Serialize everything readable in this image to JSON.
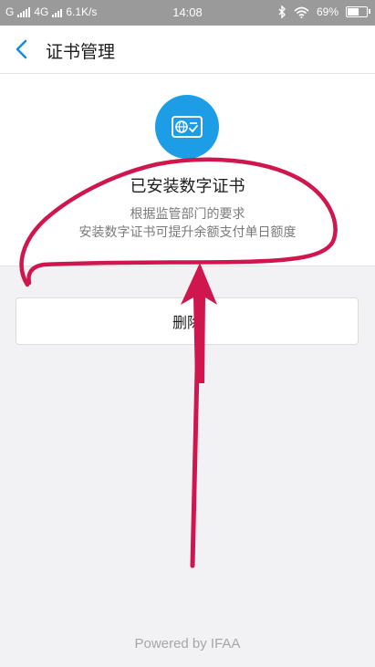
{
  "status_bar": {
    "carrier_1": "G",
    "carrier_2": "4G",
    "network_speed": "6.1K/s",
    "time": "14:08",
    "battery": "69%",
    "battery_level": 0.69,
    "icons": [
      "signal-icon",
      "bluetooth-icon",
      "wifi-icon",
      "battery-icon"
    ]
  },
  "nav": {
    "title": "证书管理",
    "back_icon": "chevron-left-icon"
  },
  "certificate": {
    "icon": "globe-certificate-icon",
    "status_title": "已安装数字证书",
    "desc_line1": "根据监管部门的要求",
    "desc_line2": "安装数字证书可提升余额支付单日额度"
  },
  "actions": {
    "delete_label": "删除"
  },
  "footer": {
    "powered_by": "Powered by IFAA"
  },
  "colors": {
    "accent": "#1c9de6",
    "annotation": "#d0164e",
    "background": "#f2f2f4"
  }
}
